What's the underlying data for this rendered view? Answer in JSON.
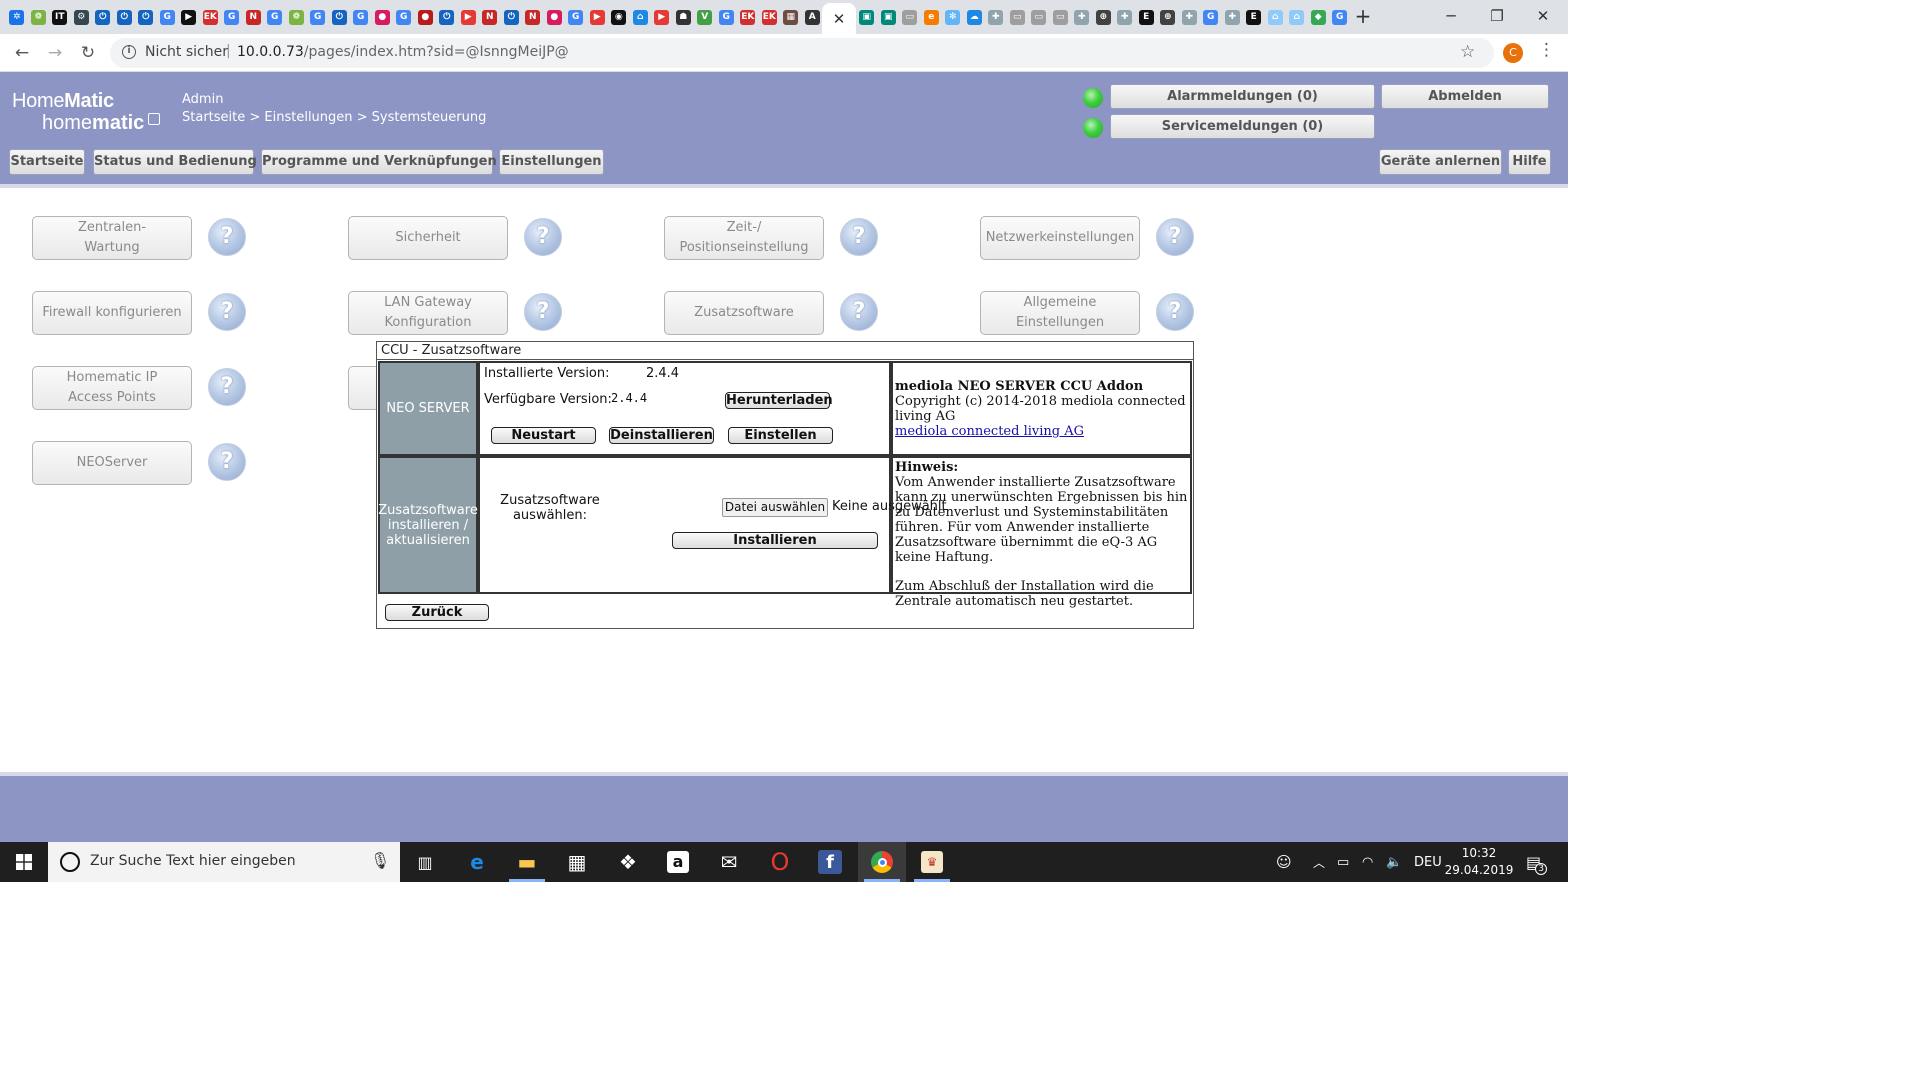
{
  "browser": {
    "favicon_tabs": [
      {
        "icon": "grid-icon",
        "glyph": "✲",
        "bg": "#1a73e8"
      },
      {
        "icon": "leaf-icon",
        "glyph": "❁",
        "bg": "#7cb342"
      },
      {
        "icon": "ite-icon",
        "glyph": "IT",
        "bg": "#111111"
      },
      {
        "icon": "gear-icon",
        "glyph": "⚙",
        "bg": "#37474f"
      },
      {
        "icon": "power-icon",
        "glyph": "⏻",
        "bg": "#1565c0"
      },
      {
        "icon": "power-icon",
        "glyph": "⏻",
        "bg": "#1565c0"
      },
      {
        "icon": "power-icon",
        "glyph": "⏻",
        "bg": "#1565c0"
      },
      {
        "icon": "google-icon",
        "glyph": "G",
        "bg": "#4285f4"
      },
      {
        "icon": "play-icon",
        "glyph": "▶",
        "bg": "#111111"
      },
      {
        "icon": "elko-icon",
        "glyph": "EK",
        "bg": "#d32f2f"
      },
      {
        "icon": "google-icon",
        "glyph": "G",
        "bg": "#4285f4"
      },
      {
        "icon": "n-icon",
        "glyph": "N",
        "bg": "#c62828"
      },
      {
        "icon": "google-icon",
        "glyph": "G",
        "bg": "#4285f4"
      },
      {
        "icon": "leaf-icon",
        "glyph": "❁",
        "bg": "#7cb342"
      },
      {
        "icon": "google-icon",
        "glyph": "G",
        "bg": "#4285f4"
      },
      {
        "icon": "power-icon",
        "glyph": "⏻",
        "bg": "#1565c0"
      },
      {
        "icon": "google-icon",
        "glyph": "G",
        "bg": "#4285f4"
      },
      {
        "icon": "apple-icon",
        "glyph": "●",
        "bg": "#d81b60"
      },
      {
        "icon": "google-icon",
        "glyph": "G",
        "bg": "#4285f4"
      },
      {
        "icon": "circle-icon",
        "glyph": "●",
        "bg": "#b71c1c"
      },
      {
        "icon": "power-icon",
        "glyph": "⏻",
        "bg": "#1565c0"
      },
      {
        "icon": "youtube-icon",
        "glyph": "▶",
        "bg": "#e53935"
      },
      {
        "icon": "n-icon",
        "glyph": "N",
        "bg": "#c62828"
      },
      {
        "icon": "power-icon",
        "glyph": "⏻",
        "bg": "#1565c0"
      },
      {
        "icon": "n-icon",
        "glyph": "N",
        "bg": "#c62828"
      },
      {
        "icon": "apple-icon",
        "glyph": "●",
        "bg": "#d81b60"
      },
      {
        "icon": "google-icon",
        "glyph": "G",
        "bg": "#4285f4"
      },
      {
        "icon": "youtube-icon",
        "glyph": "▶",
        "bg": "#e53935"
      },
      {
        "icon": "github-icon",
        "glyph": "◉",
        "bg": "#111111"
      },
      {
        "icon": "home-icon",
        "glyph": "⌂",
        "bg": "#1e88e5"
      },
      {
        "icon": "youtube-icon",
        "glyph": "▶",
        "bg": "#e53935"
      },
      {
        "icon": "robot-icon",
        "glyph": "☗",
        "bg": "#333333"
      },
      {
        "icon": "v-icon",
        "glyph": "V",
        "bg": "#43a047"
      },
      {
        "icon": "google-icon",
        "glyph": "G",
        "bg": "#4285f4"
      },
      {
        "icon": "elko-icon",
        "glyph": "EK",
        "bg": "#d32f2f"
      },
      {
        "icon": "elko-icon",
        "glyph": "EK",
        "bg": "#d32f2f"
      },
      {
        "icon": "photo-icon",
        "glyph": "▦",
        "bg": "#6d4c41"
      },
      {
        "icon": "at-icon",
        "glyph": "A",
        "bg": "#333333"
      }
    ],
    "favicon_tabs_right": [
      {
        "icon": "square-icon",
        "glyph": "▣",
        "bg": "#00897b"
      },
      {
        "icon": "square-icon",
        "glyph": "▣",
        "bg": "#00897b"
      },
      {
        "icon": "doc-icon",
        "glyph": "▭",
        "bg": "#9e9e9e"
      },
      {
        "icon": "e-icon",
        "glyph": "e",
        "bg": "#f57c00"
      },
      {
        "icon": "snow-icon",
        "glyph": "✻",
        "bg": "#64b5f6"
      },
      {
        "icon": "cloud-icon",
        "glyph": "☁",
        "bg": "#1e88e5"
      },
      {
        "icon": "puzzle-icon",
        "glyph": "✚",
        "bg": "#90a4ae"
      },
      {
        "icon": "doc-icon",
        "glyph": "▭",
        "bg": "#9e9e9e"
      },
      {
        "icon": "doc-icon",
        "glyph": "▭",
        "bg": "#9e9e9e"
      },
      {
        "icon": "doc-icon",
        "glyph": "▭",
        "bg": "#9e9e9e"
      },
      {
        "icon": "puzzle-icon",
        "glyph": "✚",
        "bg": "#90a4ae"
      },
      {
        "icon": "plus-circle-icon",
        "glyph": "⊕",
        "bg": "#424242"
      },
      {
        "icon": "puzzle-icon",
        "glyph": "✚",
        "bg": "#90a4ae"
      },
      {
        "icon": "elv-icon",
        "glyph": "E",
        "bg": "#111111"
      },
      {
        "icon": "plus-circle-icon",
        "glyph": "⊕",
        "bg": "#424242"
      },
      {
        "icon": "puzzle-icon",
        "glyph": "✚",
        "bg": "#90a4ae"
      },
      {
        "icon": "google-icon",
        "glyph": "G",
        "bg": "#4285f4"
      },
      {
        "icon": "puzzle-icon",
        "glyph": "✚",
        "bg": "#90a4ae"
      },
      {
        "icon": "elv-icon",
        "glyph": "E",
        "bg": "#111111"
      },
      {
        "icon": "house-icon",
        "glyph": "⌂",
        "bg": "#90caf9"
      },
      {
        "icon": "house-icon",
        "glyph": "⌂",
        "bg": "#90caf9"
      },
      {
        "icon": "maps-icon",
        "glyph": "◆",
        "bg": "#34a853"
      },
      {
        "icon": "google-icon",
        "glyph": "G",
        "bg": "#4285f4"
      }
    ],
    "active_tab_close": "✕",
    "new_tab": "+",
    "security_label": "Nicht sicher",
    "url_host": "10.0.0.73",
    "url_rest": "/pages/index.htm?sid=@IsnngMeiJP@",
    "profile_initial": "C"
  },
  "header": {
    "logo_line1_prefix": "Home",
    "logo_line1_bold": "Matic",
    "logo_line2_prefix": "home",
    "logo_line2_bold": "matic",
    "user": "Admin",
    "breadcrumb": "Startseite > Einstellungen > Systemsteuerung",
    "alarm_button": "Alarmmeldungen (0)",
    "service_button": "Servicemeldungen (0)",
    "logout_button": "Abmelden",
    "menu": [
      "Startseite",
      "Status und Bedienung",
      "Programme und Verknüpfungen",
      "Einstellungen"
    ],
    "menu_right": [
      "Geräte anlernen",
      "Hilfe"
    ],
    "led_color": "#3fcf3f"
  },
  "settings": {
    "buttons": [
      "Zentralen-\nWartung",
      "Sicherheit",
      "Zeit-/\nPositionseinstellung",
      "Netzwerkeinstellungen",
      "Firewall konfigurieren",
      "LAN Gateway\nKonfiguration",
      "Zusatzsoftware",
      "Allgemeine\nEinstellungen",
      "Homematic IP\nAccess Points",
      "",
      "NEOServer"
    ],
    "help_glyph": "?"
  },
  "dialog": {
    "title": "CCU - Zusatzsoftware",
    "neo": {
      "label": "NEO SERVER",
      "installed_label": "Installierte Version:",
      "installed_value": "2.4.4",
      "available_label": "Verfügbare Version:",
      "available_value": "2.4.4",
      "download_button": "Herunterladen",
      "restart_button": "Neustart",
      "uninstall_button": "Deinstallieren",
      "settings_button": "Einstellen",
      "addon_title": "mediola NEO SERVER CCU Addon",
      "addon_copyright": "Copyright (c) 2014-2018 mediola connected living AG",
      "addon_link": "mediola connected living AG"
    },
    "install": {
      "label": "Zusatzsoftware installieren / aktualisieren",
      "select_label": "Zusatzsoftware auswählen:",
      "file_button": "Datei auswählen",
      "file_status": "Keine ausgewählt",
      "install_button": "Installieren",
      "hint_title": "Hinweis:",
      "hint_text": "Vom Anwender installierte Zusatzsoftware kann zu unerwünschten Ergebnissen bis hin zu Datenverlust und Systeminstabilitäten führen. Für vom Anwender installierte Zusatzsoftware übernimmt die eQ-3 AG keine Haftung.",
      "hint_text2": "Zum Abschluß der Installation wird die Zentrale automatisch neu gestartet."
    },
    "back_button": "Zurück"
  },
  "taskbar": {
    "search_placeholder": "Zur Suche Text hier eingeben",
    "language": "DEU",
    "time": "10:32",
    "date": "29.04.2019",
    "notification_count": "3"
  }
}
